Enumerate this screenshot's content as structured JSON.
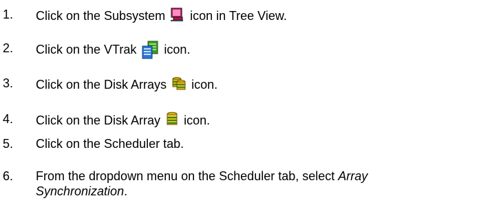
{
  "steps": [
    {
      "number": "1.",
      "before": "Click on the Subsystem",
      "icon": "subsystem-icon",
      "after": "icon in Tree View."
    },
    {
      "number": "2.",
      "before": "Click on the VTrak",
      "icon": "vtrak-icon",
      "after": "icon."
    },
    {
      "number": "3.",
      "before": "Click on the Disk Arrays",
      "icon": "disk-arrays-icon",
      "after": "icon."
    },
    {
      "number": "4.",
      "before": "Click on the Disk Array",
      "icon": "disk-array-icon",
      "after": "icon."
    },
    {
      "number": "5.",
      "text": "Click on the Scheduler tab."
    },
    {
      "number": "6.",
      "before": "From the dropdown menu on the Scheduler tab, select",
      "emphasis_line1": "Array",
      "emphasis_line2": "Synchronization",
      "end": "."
    }
  ]
}
